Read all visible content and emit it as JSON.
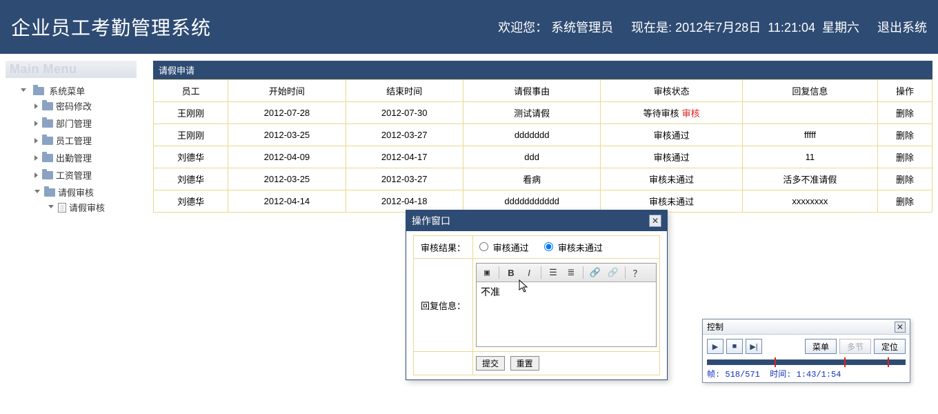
{
  "header": {
    "title": "企业员工考勤管理系统",
    "welcome_prefix": "欢迎您：",
    "user": "系统管理员",
    "now_prefix": "现在是:",
    "date": "2012年7月28日",
    "time": "11:21:04",
    "weekday": "星期六",
    "logout": "退出系统"
  },
  "sidebar": {
    "menu_title": "Main Menu",
    "root": "系统菜单",
    "items": [
      {
        "label": "密码修改"
      },
      {
        "label": "部门管理"
      },
      {
        "label": "员工管理"
      },
      {
        "label": "出勤管理"
      },
      {
        "label": "工资管理"
      },
      {
        "label": "请假审核",
        "children": [
          {
            "label": "请假审核"
          }
        ]
      }
    ]
  },
  "panel": {
    "title": "请假申请",
    "headers": [
      "员工",
      "开始时间",
      "结束时间",
      "请假事由",
      "审核状态",
      "回复信息",
      "操作"
    ],
    "rows": [
      {
        "emp": "王刚刚",
        "start": "2012-07-28",
        "end": "2012-07-30",
        "reason": "测试请假",
        "status": "等待审核",
        "status_action": "审核",
        "reply": "",
        "op": "删除"
      },
      {
        "emp": "王刚刚",
        "start": "2012-03-25",
        "end": "2012-03-27",
        "reason": "ddddddd",
        "status": "审核通过",
        "reply": "fffff",
        "op": "删除"
      },
      {
        "emp": "刘德华",
        "start": "2012-04-09",
        "end": "2012-04-17",
        "reason": "ddd",
        "status": "审核通过",
        "reply": "11",
        "op": "删除"
      },
      {
        "emp": "刘德华",
        "start": "2012-03-25",
        "end": "2012-03-27",
        "reason": "看病",
        "status": "审核未通过",
        "reply": "活多不准请假",
        "op": "删除"
      },
      {
        "emp": "刘德华",
        "start": "2012-04-14",
        "end": "2012-04-18",
        "reason": "ddddddddddd",
        "status": "审核未通过",
        "reply": "xxxxxxxx",
        "op": "删除"
      }
    ]
  },
  "dialog": {
    "title": "操作窗口",
    "result_label": "审核结果：",
    "opt_pass": "审核通过",
    "opt_fail": "审核未通过",
    "reply_label": "回复信息：",
    "reply_value": "不准",
    "submit": "提交",
    "reset": "重置"
  },
  "control": {
    "title": "控制",
    "menu": "菜单",
    "multi": "多节",
    "locate": "定位",
    "frame_label": "帧:",
    "frame_value": "518/571",
    "time_label": "时间:",
    "time_value": "1:43/1:54",
    "ticks_pct": [
      34,
      69,
      91
    ]
  }
}
